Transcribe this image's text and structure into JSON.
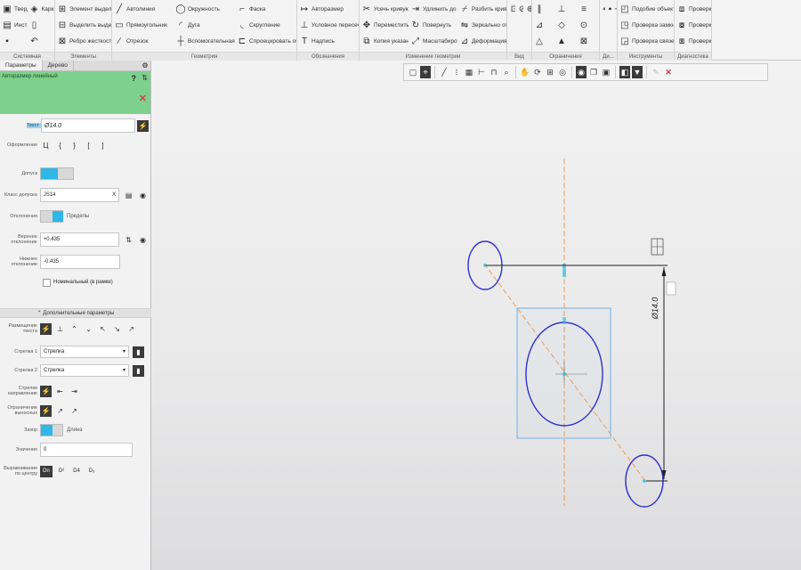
{
  "ribbon": {
    "groups": [
      {
        "label": "Системная",
        "items": [
          {
            "icon": "solid-model-icon",
            "glyph": "▣",
            "label": "Твердотельное моделирование"
          },
          {
            "icon": "surface-icon",
            "glyph": "◈",
            "label": "Каркас и поверхности"
          },
          {
            "icon": "instrument-icon",
            "glyph": "▤",
            "label": "Инструменты эскиза"
          },
          {
            "icon": "file-icon",
            "glyph": "▯",
            "label": ""
          },
          {
            "icon": "save-icon",
            "glyph": "▪",
            "label": ""
          },
          {
            "icon": "undo-icon",
            "glyph": "↶",
            "label": ""
          }
        ]
      },
      {
        "label": "Элементы",
        "items": [
          {
            "icon": "element-select-icon",
            "glyph": "⊞",
            "label": "Элемент выделения"
          },
          {
            "icon": "extrude-select-icon",
            "glyph": "⊟",
            "label": "Выделить выделенные"
          },
          {
            "icon": "rib-icon",
            "glyph": "⊠",
            "label": "Ребро жесткости"
          }
        ]
      },
      {
        "label": "Геометрия",
        "items": [
          {
            "icon": "autoline-icon",
            "glyph": "╱",
            "label": "Автолиния"
          },
          {
            "icon": "circle-icon",
            "glyph": "◯",
            "label": "Окружность"
          },
          {
            "icon": "chamfer-icon",
            "glyph": "⌐",
            "label": "Фаска"
          },
          {
            "icon": "rectangle-icon",
            "glyph": "▭",
            "label": "Прямоугольник"
          },
          {
            "icon": "arc-icon",
            "glyph": "◜",
            "label": "Дуга"
          },
          {
            "icon": "fillet-icon",
            "glyph": "◟",
            "label": "Скругление"
          },
          {
            "icon": "segment-icon",
            "glyph": "∕",
            "label": "Отрезок"
          },
          {
            "icon": "aux-line-icon",
            "glyph": "┼",
            "label": "Вспомогательная прямая"
          },
          {
            "icon": "offset-icon",
            "glyph": "⊏",
            "label": "Спроецировать объект"
          }
        ]
      },
      {
        "label": "Обозначения",
        "items": [
          {
            "icon": "auto-dim-icon",
            "glyph": "↦",
            "label": "Авторазмер"
          },
          {
            "icon": "conditional-icon",
            "glyph": "⊥",
            "label": "Условное пересечение"
          },
          {
            "icon": "text-icon",
            "glyph": "T",
            "label": "Надпись"
          }
        ]
      },
      {
        "label": "Изменение геометрии",
        "items": [
          {
            "icon": "trim-curve-icon",
            "glyph": "✂",
            "label": "Усечь кривую"
          },
          {
            "icon": "extend-icon",
            "glyph": "⇥",
            "label": "Удлинить до ближайшего о..."
          },
          {
            "icon": "split-curve-icon",
            "glyph": "⌿",
            "label": "Разбить кривую"
          },
          {
            "icon": "move-coord-icon",
            "glyph": "✥",
            "label": "Переместить по координатам"
          },
          {
            "icon": "rotate-icon",
            "glyph": "↻",
            "label": "Повернуть"
          },
          {
            "icon": "mirror-icon",
            "glyph": "⇋",
            "label": "Зеркально отразить"
          },
          {
            "icon": "copy-icon",
            "glyph": "⧉",
            "label": "Копия указанием"
          },
          {
            "icon": "scale-icon",
            "glyph": "⤢",
            "label": "Масштабирование"
          },
          {
            "icon": "deform-icon",
            "glyph": "⊿",
            "label": "Деформация сдвигом"
          }
        ]
      },
      {
        "label": "Вид",
        "items": [
          {
            "icon": "view-1-icon",
            "glyph": "⊡",
            "label": ""
          },
          {
            "icon": "view-2-icon",
            "glyph": "⊘",
            "label": ""
          },
          {
            "icon": "view-3-icon",
            "glyph": "⊕",
            "label": ""
          }
        ]
      },
      {
        "label": "Ограничения",
        "items": [
          {
            "icon": "constr-1-icon",
            "glyph": "∥",
            "label": ""
          },
          {
            "icon": "constr-2-icon",
            "glyph": "⊥",
            "label": ""
          },
          {
            "icon": "constr-3-icon",
            "glyph": "≡",
            "label": ""
          },
          {
            "icon": "constr-4-icon",
            "glyph": "⊿",
            "label": ""
          },
          {
            "icon": "constr-5-icon",
            "glyph": "◇",
            "label": ""
          },
          {
            "icon": "constr-6-icon",
            "glyph": "⊙",
            "label": ""
          },
          {
            "icon": "constr-7-icon",
            "glyph": "△",
            "label": ""
          },
          {
            "icon": "constr-8-icon",
            "glyph": "▲",
            "label": ""
          },
          {
            "icon": "constr-9-icon",
            "glyph": "⊠",
            "label": ""
          }
        ]
      },
      {
        "label": "Ди...",
        "items": [
          {
            "icon": "diag-1-icon",
            "glyph": "⊶",
            "label": ""
          },
          {
            "icon": "diag-2-icon",
            "glyph": "⊷",
            "label": ""
          },
          {
            "icon": "diag-3-icon",
            "glyph": "⊸",
            "label": ""
          }
        ]
      },
      {
        "label": "Инструменты",
        "items": [
          {
            "icon": "similar-object-icon",
            "glyph": "◰",
            "label": "Подобие объекта"
          },
          {
            "icon": "check-closure-icon",
            "glyph": "◳",
            "label": "Проверка замкнутости о..."
          },
          {
            "icon": "check-links-icon",
            "glyph": "◲",
            "label": "Проверка связей объекта"
          }
        ]
      },
      {
        "label": "Диагностика",
        "items": [
          {
            "icon": "check-overlap-icon",
            "glyph": "⧈",
            "label": "Проверка наложений"
          },
          {
            "icon": "check-closure-2-icon",
            "glyph": "⧇",
            "label": "Проверка замкнутости о..."
          },
          {
            "icon": "check-size-icon",
            "glyph": "⧆",
            "label": "Проверка размеров"
          }
        ]
      }
    ]
  },
  "panel": {
    "tabs": [
      "Параметры",
      "Дерево"
    ],
    "settings_icon": "⚙",
    "command_title": "Авторазмер линейный",
    "help_glyph": "?",
    "pin_glyph": "⇅",
    "close_glyph": "✕",
    "text_label": "Текст",
    "text_value": "Ø14.0",
    "text_btn_glyph": "⚡",
    "design_label": "Оформление",
    "design_glyphs": [
      "Ц",
      "{",
      "}",
      "[",
      "]"
    ],
    "tolerance_label": "Допуск",
    "tolerance_class_label": "Класс допуска",
    "tolerance_class_value": "JS14",
    "tolerance_class_clear": "X",
    "deviations_label": "Отклонения",
    "limits_label": "Пределы",
    "upper_label": "Верхнее отклонение",
    "upper_value": "+0.435",
    "lower_label": "Нижнее отклонение",
    "lower_value": "-0.435",
    "nominal_label": "Номинальный (в рамке)",
    "extra_section": "⌃ Дополнительные параметры",
    "placement_label": "Размещение текста",
    "arrow1_label": "Стрелка 1",
    "arrow1_value": "Стрелка",
    "arrow2_label": "Стрелка 2",
    "arrow2_value": "Стрелка",
    "arrows_dir_label": "Стрелки направление",
    "ext_limit_label": "Ограничение выносных",
    "gap_label": "Зазор",
    "length_label": "Длина",
    "value_label": "Значение",
    "value_value": "0",
    "align_label": "Выравнивание по центру",
    "align_options": [
      "Dn",
      "D²",
      "D4",
      "D₅"
    ]
  },
  "toolbar2": [
    {
      "icon": "select-icon",
      "glyph": "▢"
    },
    {
      "icon": "snap-icon",
      "glyph": "⌖",
      "dark": true
    },
    {
      "icon": "sep",
      "glyph": ""
    },
    {
      "icon": "line-icon",
      "glyph": "╱"
    },
    {
      "icon": "grid-dots-icon",
      "glyph": "⁞"
    },
    {
      "icon": "grid-icon",
      "glyph": "▦"
    },
    {
      "icon": "ortho-icon",
      "glyph": "⊢"
    },
    {
      "icon": "magnet-icon",
      "glyph": "⊓"
    },
    {
      "icon": "zoom-icon",
      "glyph": "⌕"
    },
    {
      "icon": "sep",
      "glyph": ""
    },
    {
      "icon": "pan-icon",
      "glyph": "✋"
    },
    {
      "icon": "rotate-view-icon",
      "glyph": "⟳"
    },
    {
      "icon": "zoom-window-icon",
      "glyph": "⊞"
    },
    {
      "icon": "fit-icon",
      "glyph": "◎"
    },
    {
      "icon": "sep",
      "glyph": ""
    },
    {
      "icon": "display-icon",
      "glyph": "◉",
      "dark": true
    },
    {
      "icon": "layers-icon",
      "glyph": "❐"
    },
    {
      "icon": "view-mode-icon",
      "glyph": "▣"
    },
    {
      "icon": "sep",
      "glyph": ""
    },
    {
      "icon": "section-icon",
      "glyph": "◧",
      "dark": true
    },
    {
      "icon": "filter-icon",
      "glyph": "▼",
      "dark": true
    },
    {
      "icon": "sep",
      "glyph": ""
    },
    {
      "icon": "pen-icon",
      "glyph": "✎",
      "faded": true
    },
    {
      "icon": "cancel-icon",
      "glyph": "✕",
      "red": true
    }
  ],
  "drawing": {
    "dimension_text": "Ø14.0",
    "colors": {
      "circle": "#2f2fd0",
      "axis": "#f19a52",
      "dim": "#222222",
      "accent": "#35c0e8",
      "frame": "#82b9e8"
    }
  }
}
